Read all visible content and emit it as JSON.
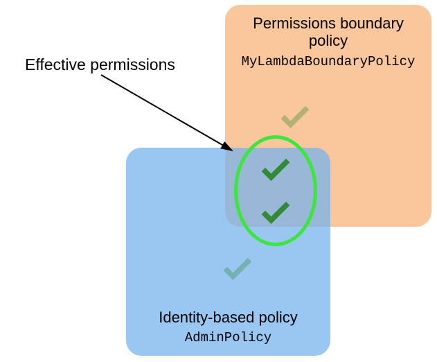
{
  "boundary": {
    "title_line1": "Permissions boundary",
    "title_line2": "policy",
    "code": "MyLambdaBoundaryPolicy"
  },
  "identity": {
    "title": "Identity-based policy",
    "code": "AdminPolicy"
  },
  "effective": {
    "label": "Effective permissions"
  },
  "colors": {
    "boundary_fill": "#f8bd8a",
    "identity_fill": "#73b2ed",
    "ring": "#3ce63c",
    "check": "#318a37"
  }
}
